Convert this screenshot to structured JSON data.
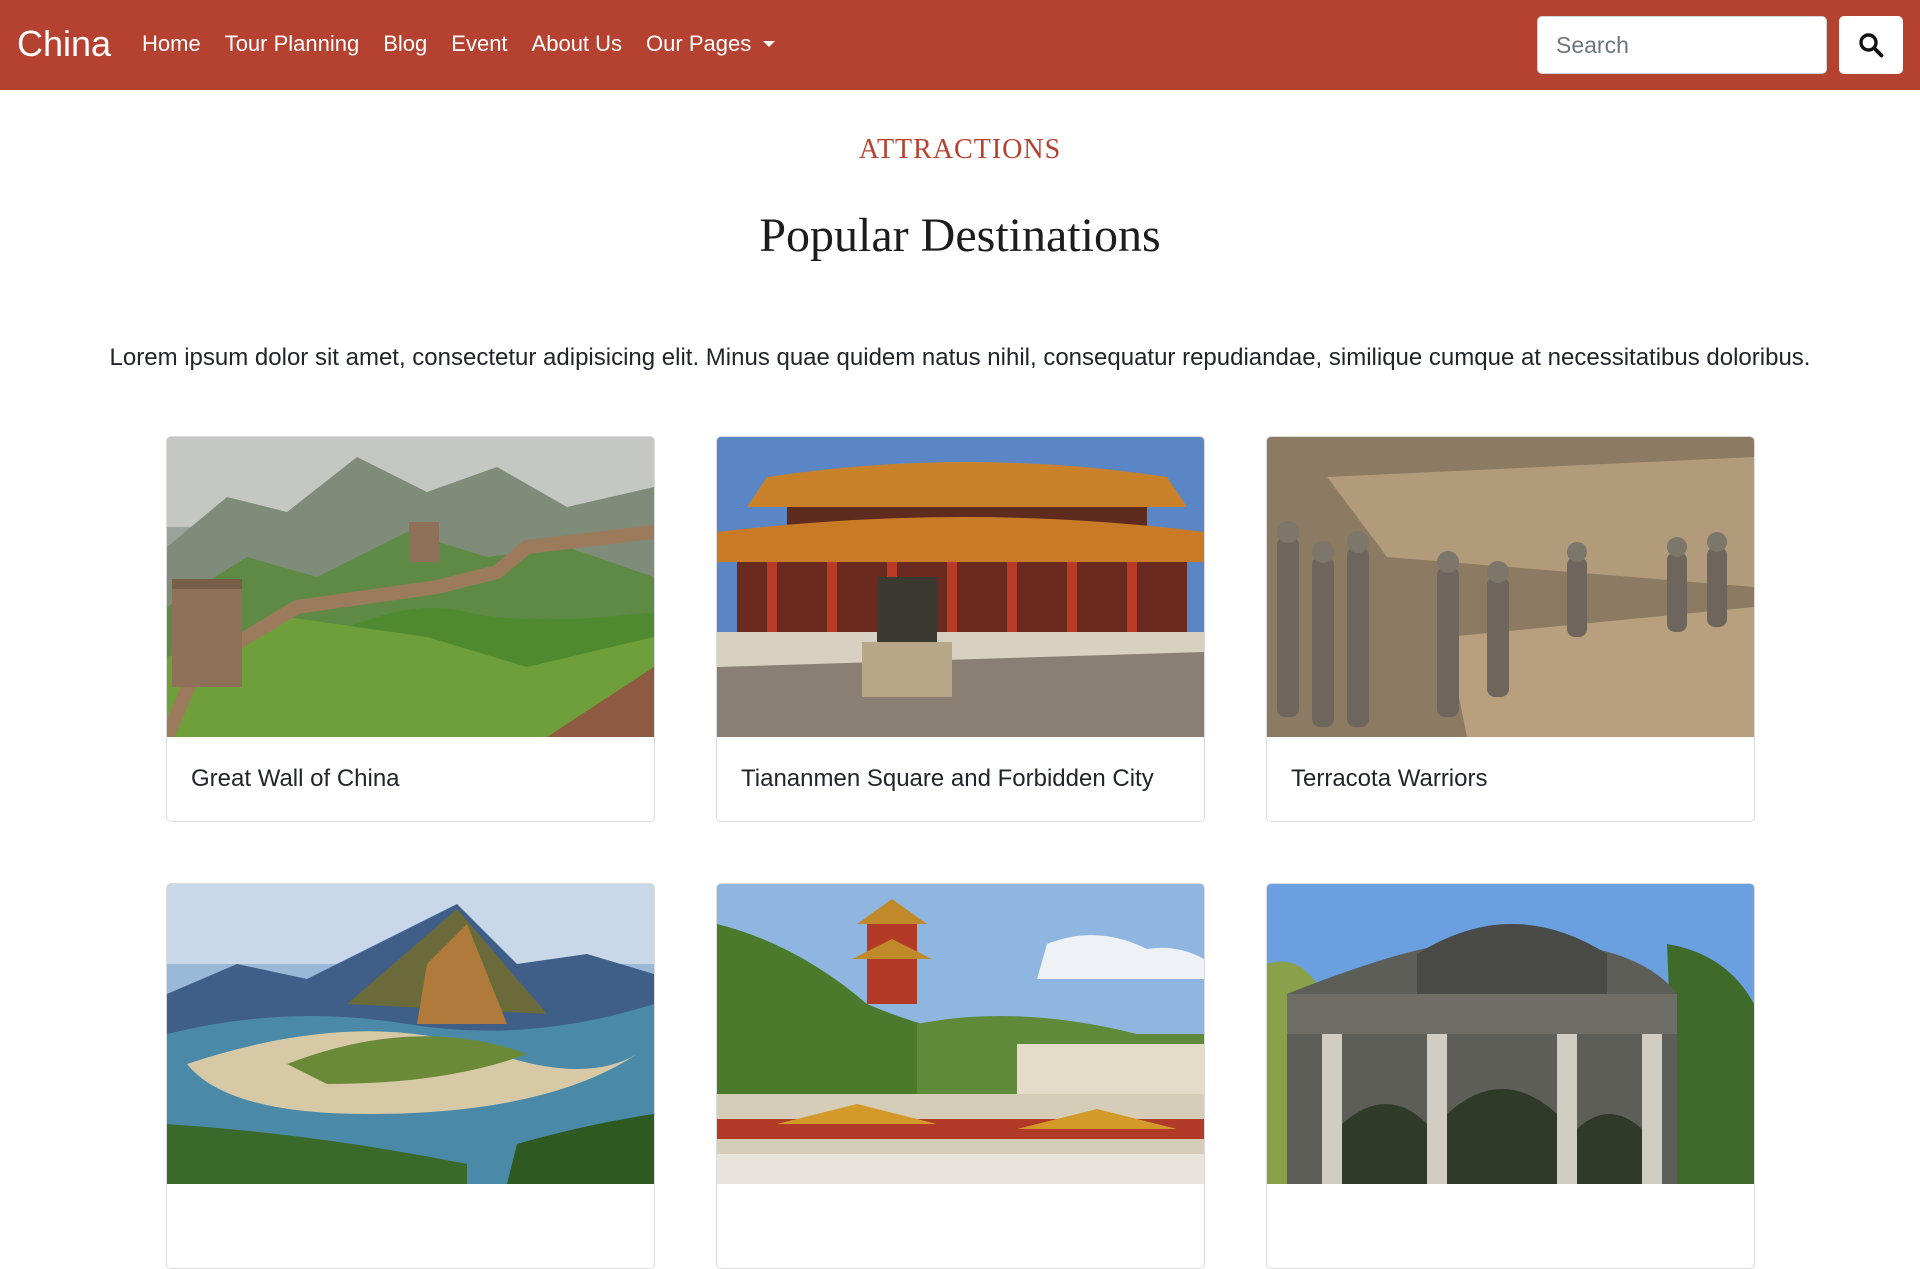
{
  "nav": {
    "brand": "China",
    "links": [
      "Home",
      "Tour Planning",
      "Blog",
      "Event",
      "About Us",
      "Our Pages"
    ],
    "search_placeholder": "Search",
    "search_icon": "magnifier-icon"
  },
  "section": {
    "eyebrow": "ATTRACTIONS",
    "title": "Popular Destinations",
    "description": "Lorem ipsum dolor sit amet, consectetur adipisicing elit. Minus quae quidem natus nihil, consequatur repudiandae, similique cumque at necessitatibus doloribus."
  },
  "destinations": [
    {
      "title": "Great Wall of China",
      "image": "great-wall-photo"
    },
    {
      "title": "Tiananmen Square and Forbidden City",
      "image": "forbidden-city-photo"
    },
    {
      "title": "Terracota Warriors",
      "image": "terracotta-warriors-photo"
    },
    {
      "title": "",
      "image": "river-valley-photo"
    },
    {
      "title": "",
      "image": "summer-palace-photo"
    },
    {
      "title": "",
      "image": "stone-gate-photo"
    }
  ],
  "colors": {
    "brand": "#b54230",
    "text": "#212529",
    "card_border": "#dcdcdc"
  }
}
